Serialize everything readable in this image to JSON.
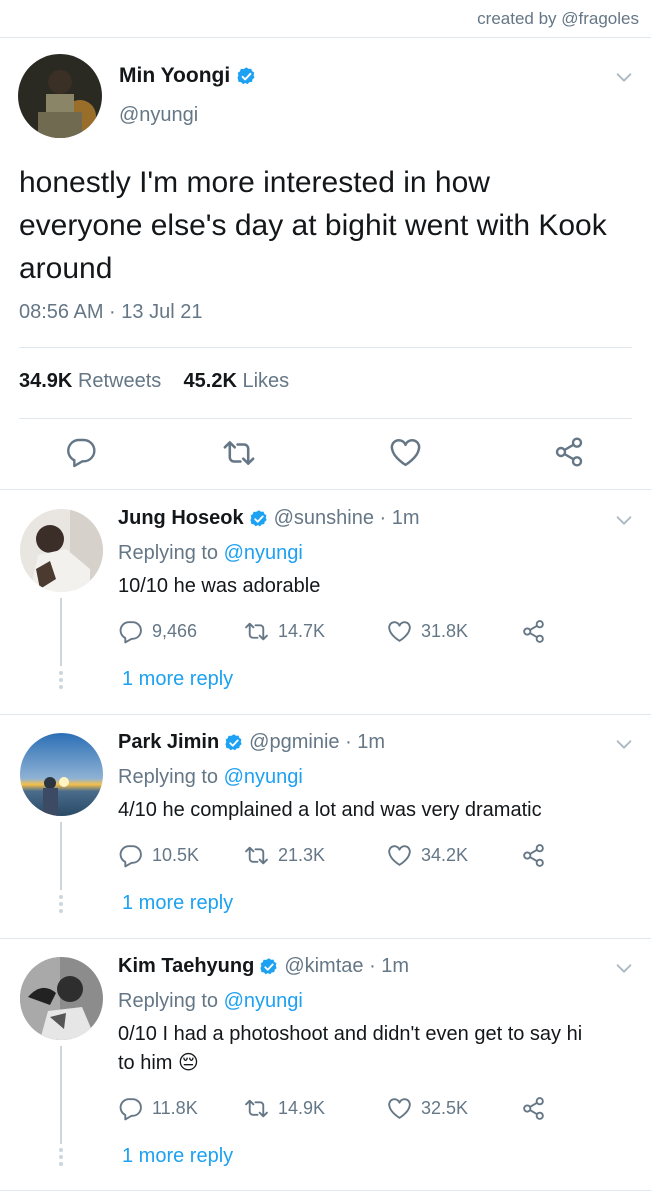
{
  "credit": "created by @fragoles",
  "colors": {
    "accent": "#1da1f2",
    "muted": "#657786",
    "text": "#14171a",
    "divider": "#e1e8ed"
  },
  "main_tweet": {
    "name": "Min Yoongi",
    "handle": "@nyungi",
    "text": "honestly I'm more interested in how everyone else's day at bighit went with Kook around",
    "timestamp": "08:56 AM · 13 Jul 21",
    "retweets_count": "34.9K",
    "retweets_label": "Retweets",
    "likes_count": "45.2K",
    "likes_label": "Likes",
    "actions": [
      "reply-icon",
      "retweet-icon",
      "like-icon",
      "share-icon"
    ]
  },
  "replies": [
    {
      "name": "Jung Hoseok",
      "handle": "@sunshine · 1m",
      "replying_prefix": "Replying to ",
      "replying_to": "@nyungi",
      "text": "10/10 he was adorable",
      "replies": "9,466",
      "retweets": "14.7K",
      "likes": "31.8K",
      "more": "1 more reply"
    },
    {
      "name": "Park Jimin",
      "handle": "@pgminie · 1m",
      "replying_prefix": "Replying to ",
      "replying_to": "@nyungi",
      "text": "4/10 he complained a lot and was very dramatic",
      "replies": "10.5K",
      "retweets": "21.3K",
      "likes": "34.2K",
      "more": "1 more reply"
    },
    {
      "name": "Kim Taehyung",
      "handle": "@kimtae · 1m",
      "replying_prefix": "Replying to ",
      "replying_to": "@nyungi",
      "text": "0/10 I had a photoshoot and didn't even get to say hi to him",
      "emoji": "😔",
      "replies": "11.8K",
      "retweets": "14.9K",
      "likes": "32.5K",
      "more": "1 more reply"
    }
  ]
}
